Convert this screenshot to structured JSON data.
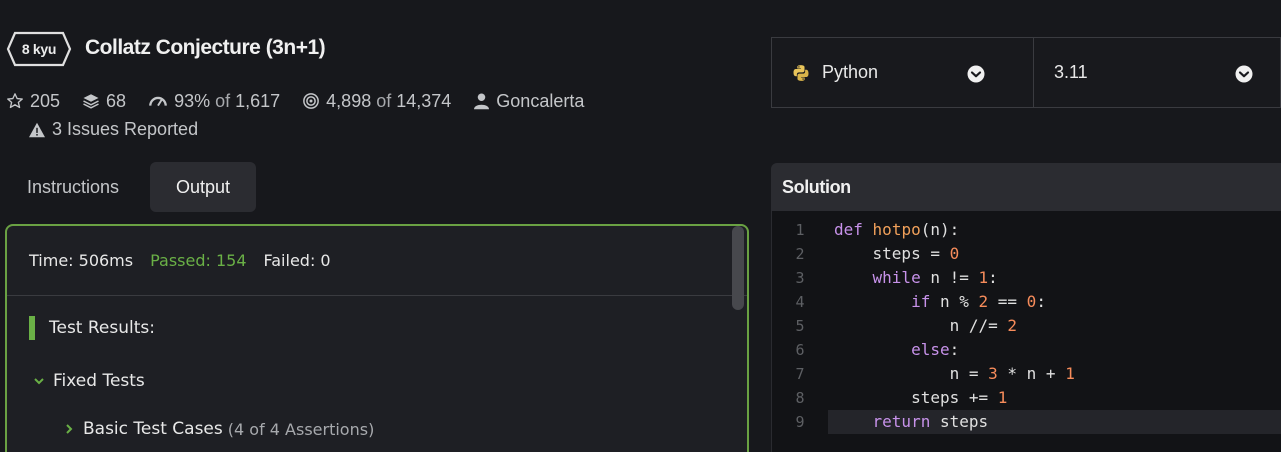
{
  "kata": {
    "rank": "8 kyu",
    "title": "Collatz Conjecture (3n+1)"
  },
  "stats": {
    "stars": "205",
    "collections": "68",
    "satisfaction_percent": "93%",
    "satisfaction_of": "of",
    "satisfaction_votes": "1,617",
    "completed": "4,898",
    "completed_of": "of",
    "completed_attempts": "14,374",
    "author": "Goncalerta",
    "issues": "3 Issues Reported"
  },
  "tabs": {
    "instructions": "Instructions",
    "output": "Output"
  },
  "output": {
    "time": "Time: 506ms",
    "passed": "Passed: 154",
    "failed": "Failed: 0",
    "results_heading": "Test Results:",
    "fixed_tests": "Fixed Tests",
    "basic_tests": "Basic Test Cases",
    "basic_tests_assertions": "(4 of 4 Assertions)"
  },
  "language_select": {
    "value": "Python",
    "icon": "python-icon"
  },
  "version_select": {
    "value": "3.11"
  },
  "solution": {
    "heading": "Solution",
    "line_numbers": [
      "1",
      "2",
      "3",
      "4",
      "5",
      "6",
      "7",
      "8",
      "9"
    ],
    "lines": [
      "def hotpo(n):",
      "    steps = 0",
      "    while n != 1:",
      "        if n % 2 == 0:",
      "            n //= 2",
      "        else:",
      "            n = 3 * n + 1",
      "        steps += 1",
      "    return steps"
    ],
    "active_line": 9
  },
  "colors": {
    "accent_green": "#6ab046",
    "panel_border": "#6aa143",
    "keyword": "#c792ea",
    "function": "#f0a05a",
    "number": "#f78c5b"
  }
}
